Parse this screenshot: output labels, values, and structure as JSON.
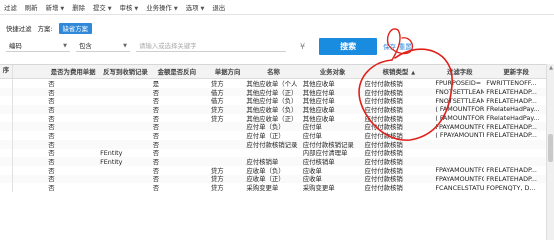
{
  "toolbar": {
    "items": [
      {
        "label": "过滤",
        "caret": false
      },
      {
        "label": "刷新",
        "caret": false
      },
      {
        "label": "新增",
        "caret": true
      },
      {
        "label": "删除",
        "caret": false
      },
      {
        "label": "提交",
        "caret": true
      },
      {
        "label": "审核",
        "caret": true
      },
      {
        "label": "业务操作",
        "caret": true
      },
      {
        "label": "选项",
        "caret": true
      },
      {
        "label": "退出",
        "caret": false
      }
    ]
  },
  "scheme": {
    "quick_filter": "快捷过滤",
    "label": "方案:",
    "default": "缺省方案"
  },
  "filter": {
    "field": "编码",
    "operator": "包含",
    "placeholder": "请输入或选择关键字",
    "search_label": "搜索",
    "save_label": "保存",
    "reset_label": "重置"
  },
  "table": {
    "row_header": "序",
    "columns": [
      "是否为费用单据",
      "反写到收销记录",
      "金额是否反向",
      "单据方向",
      "名称",
      "业务对象",
      "核销类型",
      "过滤字段",
      "更新字段"
    ],
    "sort_indicator": "▲",
    "rows": [
      [
        "否",
        "",
        "是",
        "贷方",
        "其他应收单（个人",
        "其他应收单",
        "应付付款核销",
        "FPURPOSEID=",
        "FWRITTENOFF..."
      ],
      [
        "否",
        "",
        "否",
        "借方",
        "其他应付单（正）",
        "其他应付单",
        "应付付款核销",
        "FNOTSETTLEAM",
        "FRELATEHADP..."
      ],
      [
        "否",
        "",
        "否",
        "借方",
        "其他应付单（负）",
        "其他应付单",
        "应付付款核销",
        "FNOTSETTLEAM",
        "FRELATEHADP..."
      ],
      [
        "否",
        "",
        "否",
        "贷方",
        "其他应收单（负）",
        "其他应收单",
        "应付付款核销",
        "( FAMOUNTFOR",
        "FRelateHadPay..."
      ],
      [
        "否",
        "",
        "否",
        "贷方",
        "其他应收单（正）",
        "其他应收单",
        "应付付款核销",
        "( FAMOUNTFOR",
        "FRelateHadPay..."
      ],
      [
        "否",
        "",
        "否",
        "",
        "应付单（负）",
        "应付单",
        "应付付款核销",
        "FPAYAMOUNTFC",
        "FRELATEHADP..."
      ],
      [
        "否",
        "",
        "否",
        "",
        "应付单（正）",
        "应付单",
        "应付付款核销",
        "( FPAYAMOUNTF",
        "FRELATEHADP..."
      ],
      [
        "否",
        "",
        "否",
        "",
        "应付付款核销记录",
        "应付付款核销记录",
        "应付付款核销",
        "",
        ""
      ],
      [
        "否",
        "FEntity",
        "否",
        "",
        "",
        "内部应付清理单",
        "应付付款核销",
        "",
        ""
      ],
      [
        "否",
        "FEntity",
        "否",
        "",
        "应付核销单",
        "应付核销单",
        "应付付款核销",
        "",
        ""
      ],
      [
        "否",
        "",
        "否",
        "贷方",
        "应收单（负）",
        "应收单",
        "应付付款核销",
        "FPAYAMOUNTFC",
        "FRELATEHADP..."
      ],
      [
        "否",
        "",
        "否",
        "贷方",
        "应收单（正）",
        "应收单",
        "应付付款核销",
        "FPAYAMOUNTFC",
        "FRELATEHADP..."
      ],
      [
        "否",
        "",
        "否",
        "贷方",
        "采购变更单",
        "采购变更单",
        "应付付款核销",
        "FCANCELSTATU",
        "FOPENQTY, D..."
      ]
    ]
  },
  "colors": {
    "accent": "#1a8ce0",
    "annotation": "#e0211b"
  }
}
